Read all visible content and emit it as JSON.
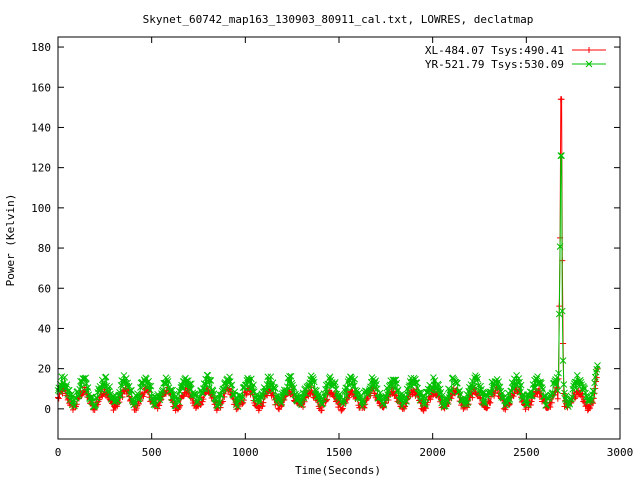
{
  "chart_data": {
    "type": "line",
    "title": "Skynet_60742_map163_130903_80911_cal.txt, LOWRES, declatmap",
    "xlabel": "Time(Seconds)",
    "ylabel": "Power (Kelvin)",
    "xlim": [
      0,
      3000
    ],
    "ylim": [
      -15,
      185
    ],
    "xticks": [
      0,
      500,
      1000,
      1500,
      2000,
      2500,
      3000
    ],
    "yticks": [
      0,
      20,
      40,
      60,
      80,
      100,
      120,
      140,
      160,
      180
    ],
    "grid": false,
    "legend_position": "top-right",
    "series": [
      {
        "name": "XL-484.07 Tsys:490.41",
        "color": "#ff0000",
        "marker": "plus",
        "baseline": 5,
        "amplitude": 4,
        "period_s": 110,
        "noise": 2,
        "sample_interval_s": 4,
        "x_end": 2880,
        "spike": {
          "x_start": 2668,
          "x_end": 2700,
          "peak_x": 2685,
          "peak": 154
        },
        "end_value": 19
      },
      {
        "name": "YR-521.79 Tsys:530.09",
        "color": "#00c000",
        "marker": "cross",
        "baseline": 9,
        "amplitude": 5,
        "period_s": 110,
        "noise": 3,
        "sample_interval_s": 4,
        "x_end": 2880,
        "spike": {
          "x_start": 2668,
          "x_end": 2700,
          "peak_x": 2685,
          "peak": 126
        },
        "end_value": 23
      }
    ]
  }
}
